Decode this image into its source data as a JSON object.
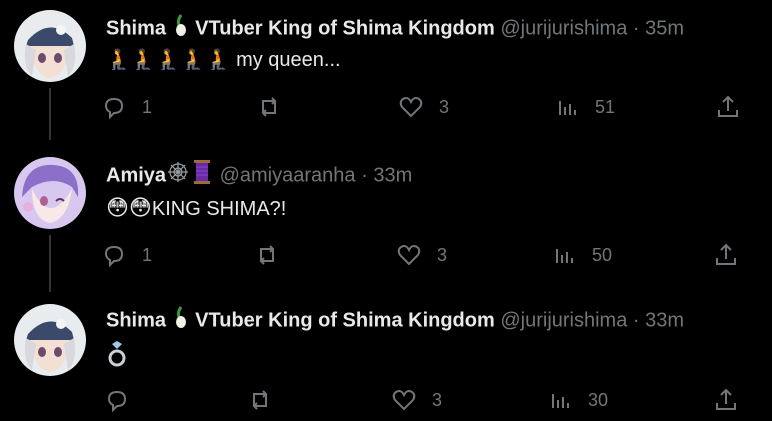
{
  "tweets": [
    {
      "display_name": "Shima",
      "name_suffix": "VTuber King of Shima Kingdom",
      "handle": "@jurijurishima",
      "dot": "·",
      "time": "35m",
      "text": "my queen...",
      "emoji_prefix": [
        "person-kneeling",
        "person-kneeling",
        "person-kneeling",
        "person-kneeling",
        "person-kneeling"
      ],
      "replies": "1",
      "reposts": "",
      "likes": "3",
      "views": "51"
    },
    {
      "display_name": "Amiya",
      "name_suffix": "",
      "handle": "@amiyaaranha",
      "dot": "·",
      "time": "33m",
      "text": "KING SHIMA?!",
      "emoji_prefix": [
        "flushed-face",
        "flushed-face"
      ],
      "replies": "1",
      "reposts": "",
      "likes": "3",
      "views": "50"
    },
    {
      "display_name": "Shima",
      "name_suffix": "VTuber King of Shima Kingdom",
      "handle": "@jurijurishima",
      "dot": "·",
      "time": "33m",
      "text": "",
      "emoji_prefix": [
        "ring"
      ],
      "replies": "",
      "reposts": "",
      "likes": "3",
      "views": "30"
    }
  ],
  "colors": {
    "background": "#000000",
    "text": "#e7e9ea",
    "muted": "#71767b",
    "thread_line": "#333639"
  }
}
